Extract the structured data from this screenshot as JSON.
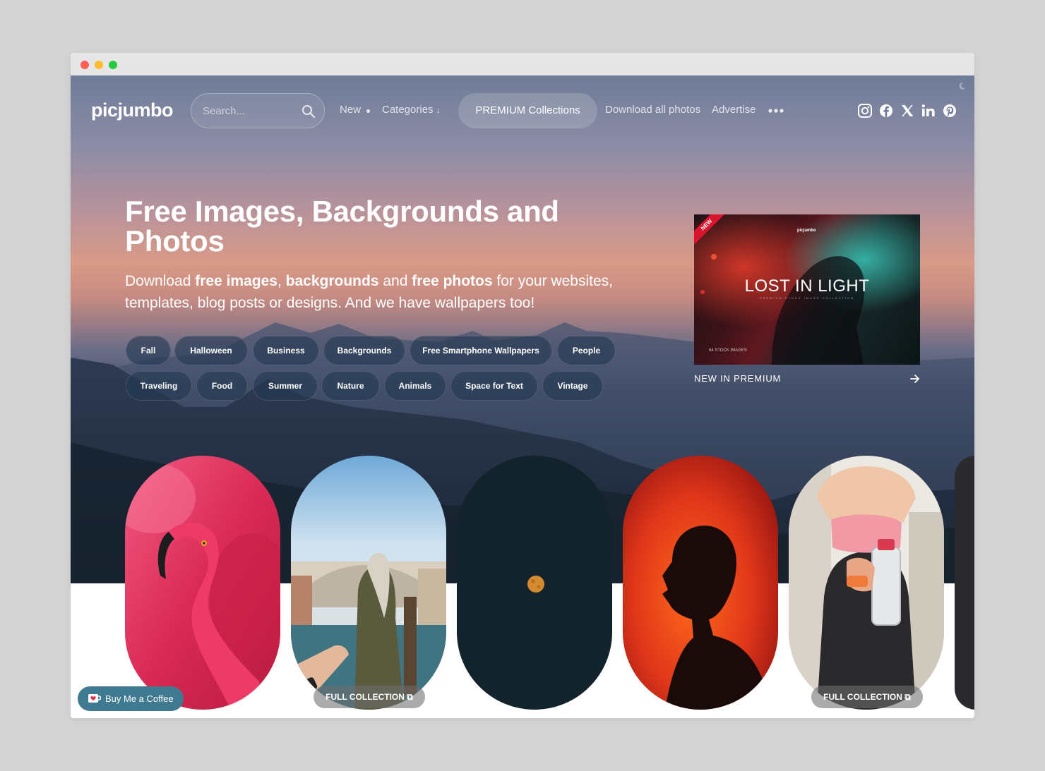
{
  "brand": {
    "logo": "picjumbo"
  },
  "search": {
    "placeholder": "Search..."
  },
  "nav": {
    "new": "New",
    "categories": "Categories",
    "categories_arrow": "↓",
    "premium": "PREMIUM Collections",
    "download_all": "Download all photos",
    "advertise": "Advertise"
  },
  "social": [
    "instagram-icon",
    "facebook-icon",
    "x-icon",
    "linkedin-icon",
    "pinterest-icon"
  ],
  "hero": {
    "title": "Free Images, Backgrounds and Photos",
    "subtitle": {
      "p1": "Download ",
      "b1": "free images",
      "p2": ", ",
      "b2": "backgrounds",
      "p3": " and ",
      "b3": "free photos",
      "p4": " for your websites, templates, blog posts or designs. And we have wallpapers too!"
    }
  },
  "tags": [
    "Fall",
    "Halloween",
    "Business",
    "Backgrounds",
    "Free Smartphone Wallpapers",
    "People",
    "Traveling",
    "Food",
    "Summer",
    "Nature",
    "Animals",
    "Space for Text",
    "Vintage"
  ],
  "promo": {
    "ribbon": "NEW",
    "brand": "picjumbo",
    "title": "LOST IN LIGHT",
    "subtitle": "PREMIUM STOCK IMAGE COLLECTION",
    "count": "64 STOCK IMAGES",
    "label": "NEW IN PREMIUM"
  },
  "gallery": {
    "full_collection": "FULL COLLECTION",
    "buy_coffee": "Buy Me a Coffee"
  },
  "colors": {
    "bmc_button": "#3f7a91",
    "promo_ribbon": "#d8152d",
    "moon_card": "#13232c"
  }
}
